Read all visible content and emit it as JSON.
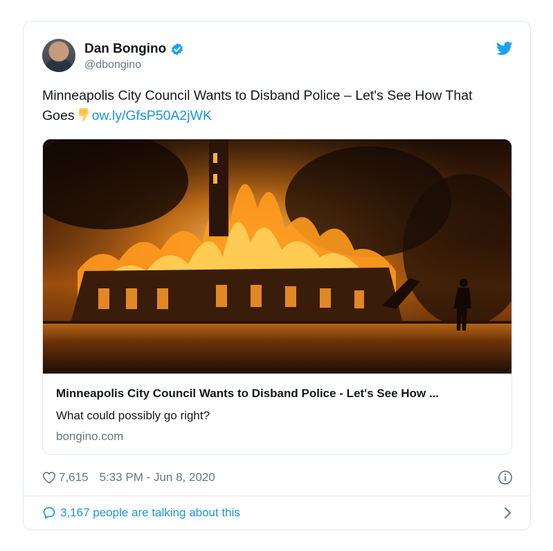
{
  "author": {
    "display_name": "Dan Bongino",
    "handle": "@dbongino",
    "verified": true,
    "avatar_icon": "avatar-photo"
  },
  "tweet": {
    "text_before": "Minneapolis City Council Wants to Disband Police – Let's See How That Goes",
    "emoji": "backhand-index-pointing-down",
    "link_text": "ow.ly/GfsP50A2jWK"
  },
  "link_card": {
    "title": "Minneapolis City Council Wants to Disband Police - Let's See How ...",
    "description": "What could possibly go right?",
    "domain": "bongino.com"
  },
  "meta": {
    "like_count": "7,615",
    "timestamp": "5:33 PM - Jun 8, 2020"
  },
  "conversation": {
    "label": "3,167 people are talking about this"
  },
  "colors": {
    "brand_blue": "#1da1f2",
    "link_blue": "#1b95e0",
    "secondary_text": "#657786",
    "border": "#e1e8ed"
  },
  "icons": [
    "verified-badge-icon",
    "twitter-bird-icon",
    "heart-icon",
    "info-icon",
    "speech-bubble-icon",
    "chevron-right-icon"
  ]
}
